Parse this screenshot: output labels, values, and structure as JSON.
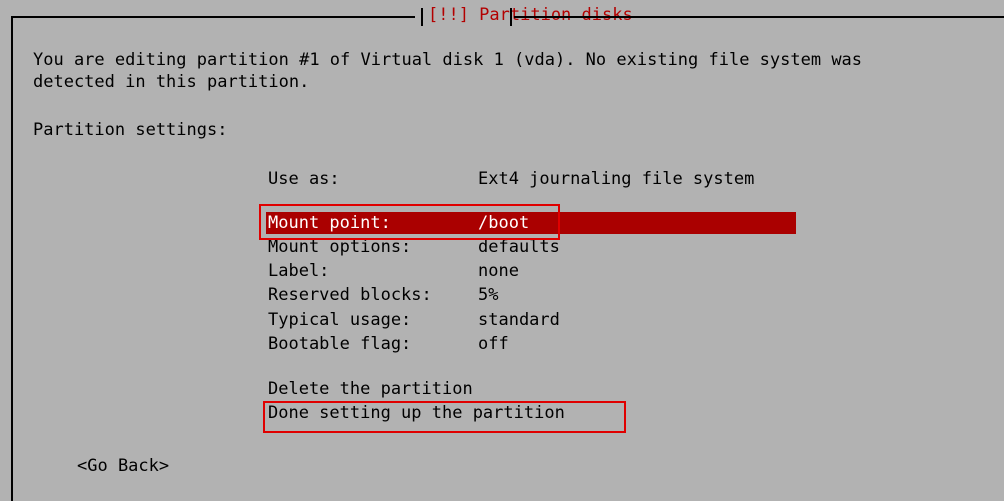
{
  "dialog": {
    "title": "[!!] Partition disks",
    "description_line1": "You are editing partition #1 of Virtual disk 1 (vda). No existing file system was",
    "description_line2": "detected in this partition.",
    "section_heading": "Partition settings:"
  },
  "settings": {
    "use_as": {
      "label": "Use as:",
      "value": "Ext4 journaling file system"
    },
    "mount_point": {
      "label": "Mount point:",
      "value": "/boot"
    },
    "mount_options": {
      "label": "Mount options:",
      "value": "defaults"
    },
    "label": {
      "label": "Label:",
      "value": "none"
    },
    "reserved_blocks": {
      "label": "Reserved blocks:",
      "value": "5%"
    },
    "typical_usage": {
      "label": "Typical usage:",
      "value": "standard"
    },
    "bootable_flag": {
      "label": "Bootable flag:",
      "value": "off"
    }
  },
  "actions": {
    "delete": "Delete the partition",
    "done": "Done setting up the partition"
  },
  "go_back": "<Go Back>",
  "colors": {
    "background": "#b2b2b2",
    "selection": "#aa0000",
    "title": "#b30000",
    "annotation_box": "#e00000"
  }
}
